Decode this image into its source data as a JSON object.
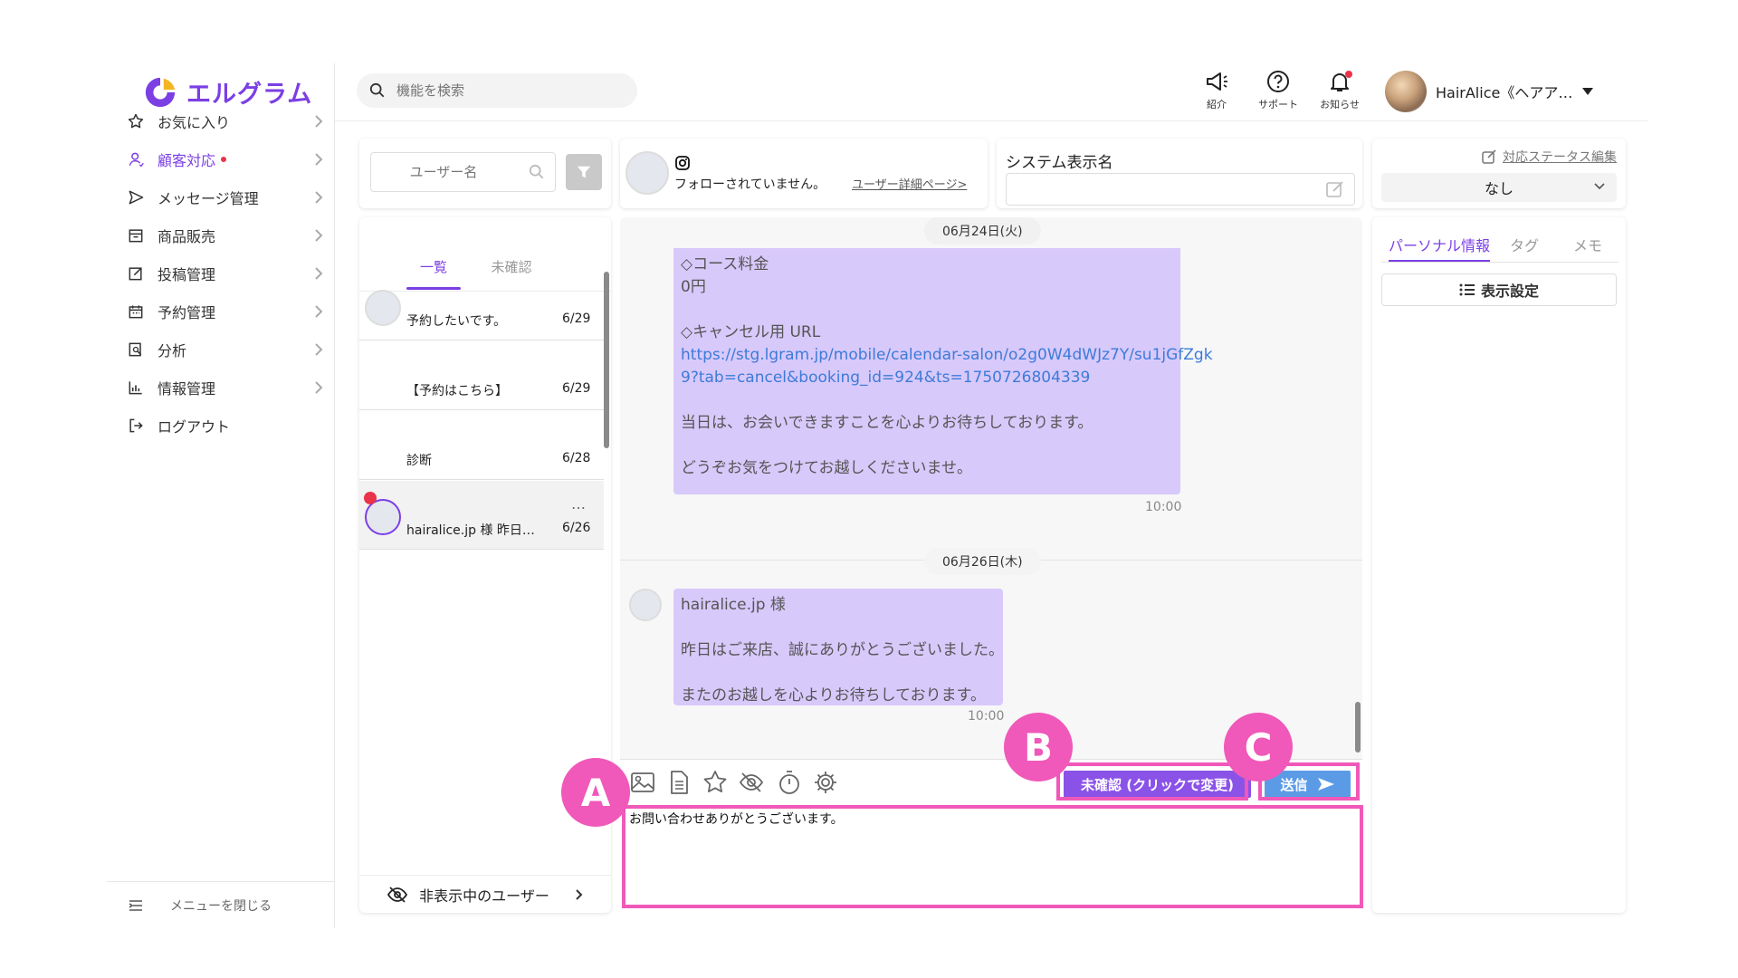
{
  "sidebar": {
    "logo_text": "エルグラム",
    "items": [
      {
        "label": "お気に入り"
      },
      {
        "label": "顧客対応"
      },
      {
        "label": "メッセージ管理"
      },
      {
        "label": "商品販売"
      },
      {
        "label": "投稿管理"
      },
      {
        "label": "予約管理"
      },
      {
        "label": "分析"
      },
      {
        "label": "情報管理"
      },
      {
        "label": "ログアウト"
      }
    ],
    "close_menu": "メニューを閉じる"
  },
  "topbar": {
    "search_placeholder": "機能を検索",
    "intro_label": "紹介",
    "support_label": "サポート",
    "notice_label": "お知らせ",
    "user_name": "HairAlice《ヘアア…"
  },
  "user_list": {
    "search_placeholder": "ユーザー名",
    "tabs": [
      "一覧",
      "未確認"
    ],
    "conversations": [
      {
        "preview": "予約したいです。",
        "date": "6/29"
      },
      {
        "preview": "【予約はこちら】",
        "date": "6/29"
      },
      {
        "preview": "診断",
        "date": "6/28"
      },
      {
        "preview": "hairalice.jp 様 昨日は…",
        "date": "6/26",
        "more": "…"
      }
    ],
    "hidden_users": "非表示中のユーザー"
  },
  "chat_header": {
    "follow_status": "フォローされていません。",
    "detail_link": "ユーザー詳細ページ>"
  },
  "system_name": {
    "label": "システム表示名"
  },
  "status_panel": {
    "edit_link": "対応ステータス編集",
    "selected": "なし"
  },
  "chat": {
    "date1": "06月24日(火)",
    "msg1_lines": [
      "◇コース料金",
      "0円",
      "",
      "◇キャンセル用 URL",
      "https://stg.lgram.jp/mobile/calendar-salon/o2g0W4dWJz7Y/su1jGfZgk",
      "9?tab=cancel&booking_id=924&ts=1750726804339",
      "",
      "当日は、お会いできますことを心よりお待ちしております。",
      "",
      "どうぞお気をつけてお越しくださいませ。"
    ],
    "msg1_time": "10:00",
    "date2": "06月26日(木)",
    "msg2_lines": [
      "hairalice.jp 様",
      "",
      "昨日はご来店、誠にありがとうございました。",
      "",
      "またのお越しを心よりお待ちしております。"
    ],
    "msg2_time": "10:00"
  },
  "composer": {
    "status_button": "未確認 (クリックで変更)",
    "send_button": "送信",
    "input_value": "お問い合わせありがとうございます。"
  },
  "right_panel": {
    "tabs": [
      "パーソナル情報",
      "タグ",
      "メモ"
    ],
    "display_settings": "表示設定"
  },
  "annotations": {
    "a": "A",
    "b": "B",
    "c": "C",
    "color": "#f058b9"
  }
}
